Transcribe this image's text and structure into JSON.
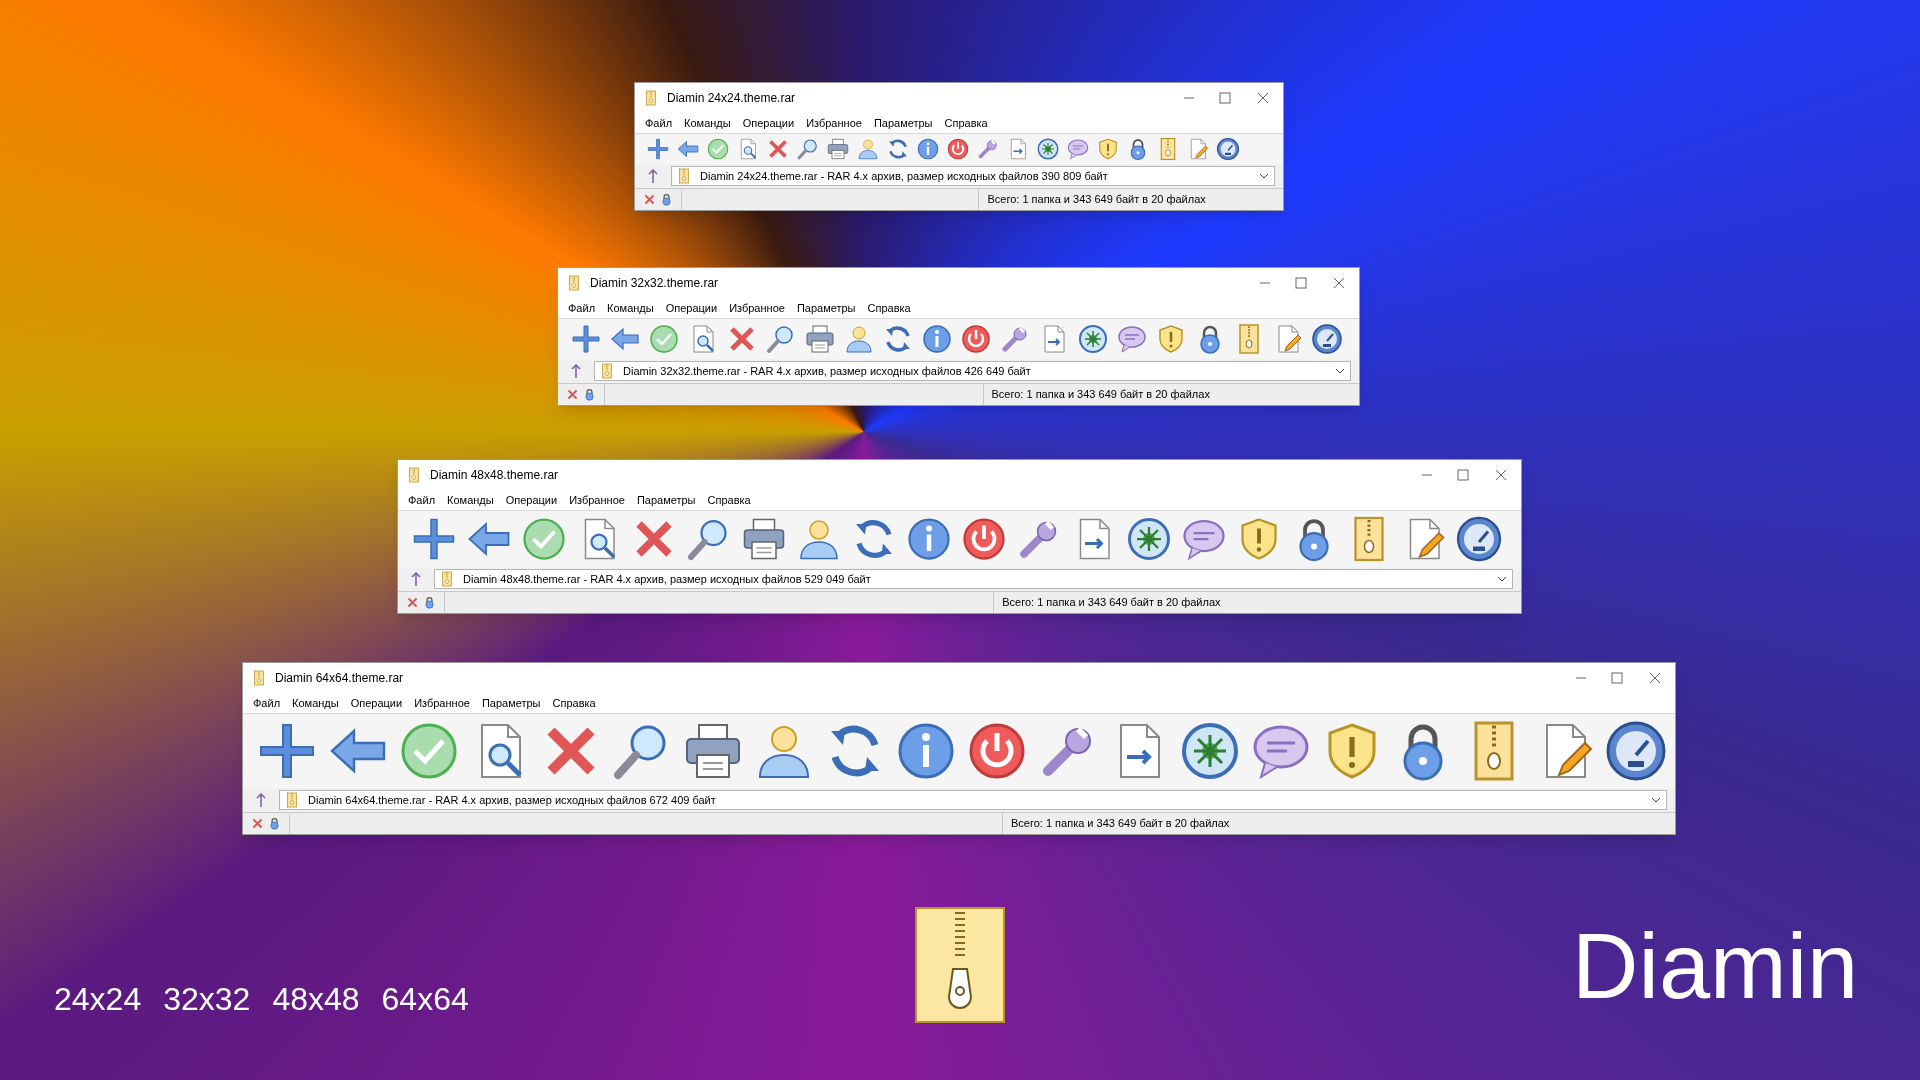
{
  "windows": [
    {
      "title": "Diamin 24x24.theme.rar",
      "menu": [
        "Файл",
        "Команды",
        "Операции",
        "Избранное",
        "Параметры",
        "Справка"
      ],
      "address": "Diamin 24x24.theme.rar - RAR 4.x архив, размер исходных файлов 390 809 байт",
      "status": "Всего: 1 папка и 343 649 байт в 20 файлах"
    },
    {
      "title": "Diamin 32x32.theme.rar",
      "menu": [
        "Файл",
        "Команды",
        "Операции",
        "Избранное",
        "Параметры",
        "Справка"
      ],
      "address": "Diamin 32x32.theme.rar - RAR 4.x архив, размер исходных файлов 426 649 байт",
      "status": "Всего: 1 папка и 343 649 байт в 20 файлах"
    },
    {
      "title": "Diamin 48x48.theme.rar",
      "menu": [
        "Файл",
        "Команды",
        "Операции",
        "Избранное",
        "Параметры",
        "Справка"
      ],
      "address": "Diamin 48x48.theme.rar - RAR 4.x архив, размер исходных файлов 529 049 байт",
      "status": "Всего: 1 папка и 343 649 байт в 20 файлах"
    },
    {
      "title": "Diamin 64x64.theme.rar",
      "menu": [
        "Файл",
        "Команды",
        "Операции",
        "Избранное",
        "Параметры",
        "Справка"
      ],
      "address": "Diamin 64x64.theme.rar - RAR 4.x архив, размер исходных файлов 672 409 байт",
      "status": "Всего: 1 папка и 343 649 байт в 20 файлах"
    }
  ],
  "size_labels": [
    "24x24",
    "32x32",
    "48x48",
    "64x64"
  ],
  "brand": "Diamin"
}
